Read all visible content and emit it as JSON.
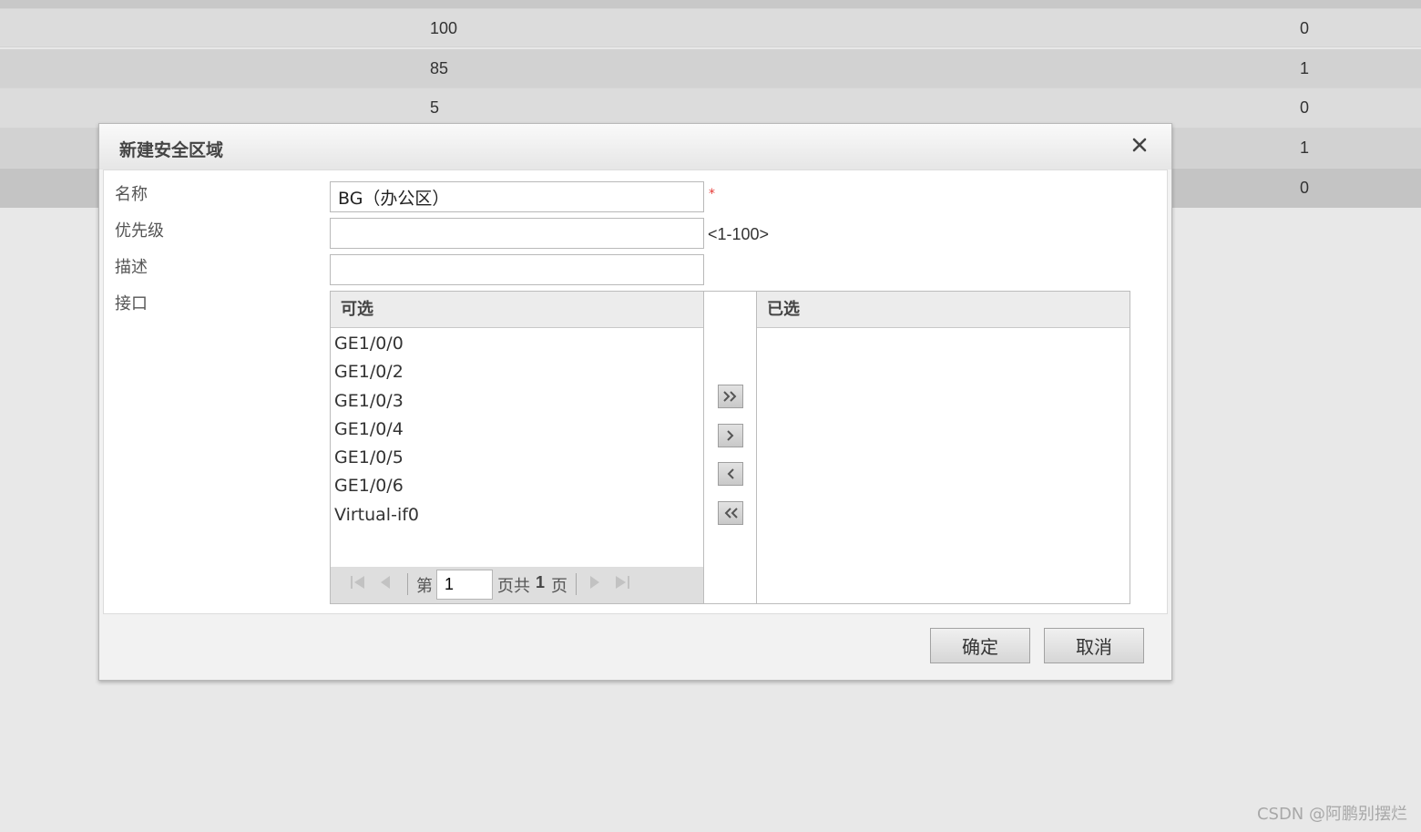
{
  "background_table": {
    "rows": [
      {
        "value": "100",
        "count": "0",
        "bg": "#dcdcdc"
      },
      {
        "value": "85",
        "count": "1",
        "bg": "#d2d2d2"
      },
      {
        "value": "5",
        "count": "0",
        "bg": "#dcdcdc"
      },
      {
        "value": "",
        "count": "1",
        "bg": "#d2d2d2"
      },
      {
        "value": "",
        "count": "0",
        "bg": "#c4c4c4"
      }
    ]
  },
  "dialog": {
    "title": "新建安全区域",
    "close_icon": "close-icon",
    "fields": {
      "name_label": "名称",
      "name_value": "BG（办公区）",
      "required_mark": "*",
      "priority_label": "优先级",
      "priority_value": "",
      "priority_hint": "<1-100>",
      "description_label": "描述",
      "description_value": "",
      "interface_label": "接口"
    },
    "available": {
      "header": "可选",
      "items": [
        "GE1/0/0",
        "GE1/0/2",
        "GE1/0/3",
        "GE1/0/4",
        "GE1/0/5",
        "GE1/0/6",
        "Virtual-if0"
      ]
    },
    "selected": {
      "header": "已选",
      "items": []
    },
    "transfer_buttons": [
      "move-all-right-icon",
      "move-right-icon",
      "move-left-icon",
      "move-all-left-icon"
    ],
    "pager": {
      "prefix": "第",
      "current_page": "1",
      "suffix_before_total": "页共",
      "total_pages": "1",
      "suffix": "页"
    },
    "buttons": {
      "ok": "确定",
      "cancel": "取消"
    }
  },
  "watermark": "CSDN @阿鹏别摆烂"
}
